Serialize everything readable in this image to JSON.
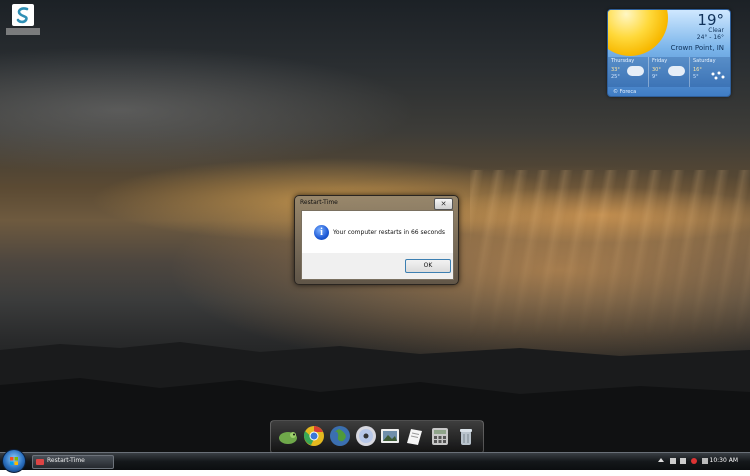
{
  "desktop": {
    "icon_label": ""
  },
  "weather": {
    "temperature": "19°",
    "condition": "Clear",
    "high_low": "24° - 16°",
    "location": "Crown Point, IN",
    "forecast": [
      {
        "day": "Thursday",
        "high": "33°",
        "low": "25°",
        "icon": "partly-cloudy-icon"
      },
      {
        "day": "Friday",
        "high": "30°",
        "low": "9°",
        "icon": "partly-cloudy-icon"
      },
      {
        "day": "Saturday",
        "high": "16°",
        "low": "5°",
        "icon": "snow-icon"
      }
    ],
    "footer": "© Foreca"
  },
  "dialog": {
    "title": "Restart-Time",
    "close_label": "✕",
    "message": "Your computer restarts in 66 seconds",
    "ok_label": "OK"
  },
  "dock": {
    "items": [
      {
        "name": "chameleon-icon"
      },
      {
        "name": "chrome-icon"
      },
      {
        "name": "globe-icon"
      },
      {
        "name": "cd-media-icon"
      },
      {
        "name": "photo-icon"
      },
      {
        "name": "notepad-icon"
      },
      {
        "name": "calculator-icon"
      },
      {
        "name": "recycle-bin-icon"
      }
    ]
  },
  "taskbar": {
    "task_title": "Restart-Time",
    "clock": "10:30 AM"
  }
}
